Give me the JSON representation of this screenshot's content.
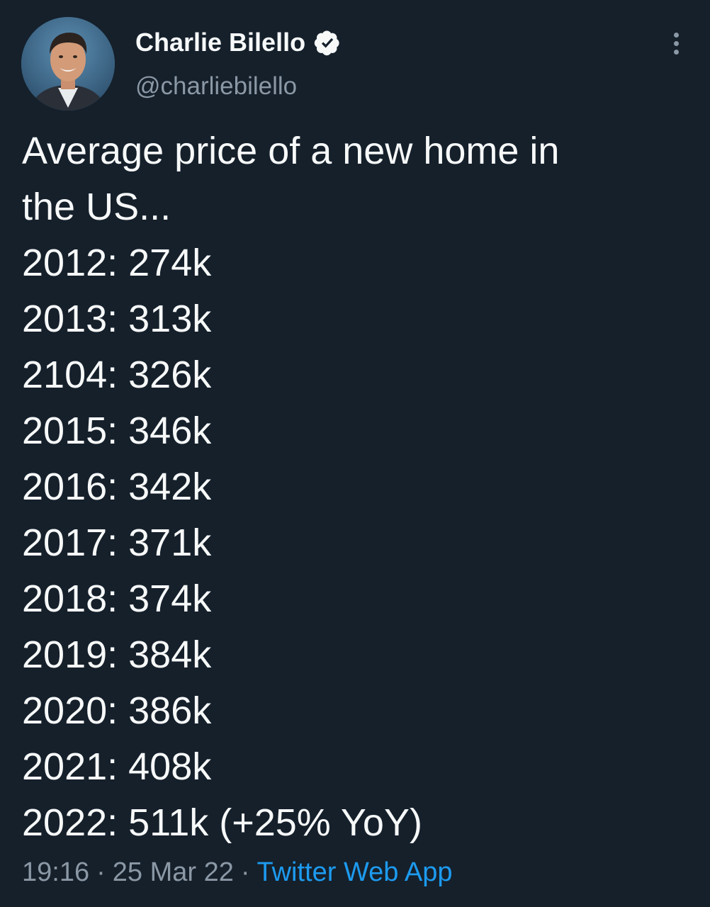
{
  "author": {
    "name": "Charlie Bilello",
    "handle": "@charliebilello",
    "verified": true,
    "avatar_icon": "profile-photo-icon"
  },
  "tweet": {
    "text_lines": [
      "Average price of a new home in",
      "the US...",
      "2012: 274k",
      "2013: 313k",
      "2104: 326k",
      "2015: 346k",
      "2016: 342k",
      "2017: 371k",
      "2018: 374k",
      "2019: 384k",
      "2020: 386k",
      "2021: 408k",
      "2022: 511k (+25% YoY)"
    ]
  },
  "meta": {
    "time": "19:16",
    "separator": "·",
    "date": "25 Mar 22",
    "source": "Twitter Web App"
  },
  "colors": {
    "background": "#15202b",
    "text": "#f7f9f9",
    "secondary": "#8b98a5",
    "accent": "#1d9bf0"
  }
}
